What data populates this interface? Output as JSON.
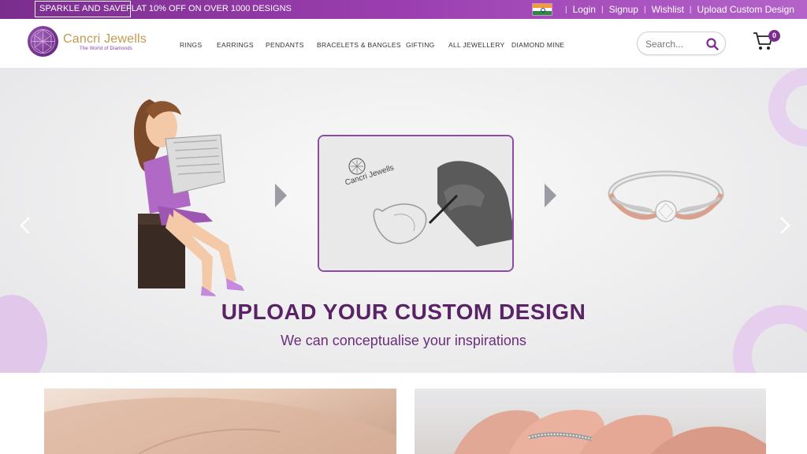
{
  "topbar": {
    "promo_badge": "SPARKLE AND SAVE",
    "promo_text": "FLAT 10% OFF ON OVER 1000 DESIGNS",
    "links": {
      "login": "Login",
      "signup": "Signup",
      "wishlist": "Wishlist",
      "upload": "Upload Custom Design"
    },
    "separator": "|"
  },
  "header": {
    "logo_name": "Cancri Jewells",
    "logo_tagline": "The World of Diamonds",
    "nav": [
      "RINGS",
      "EARRINGS",
      "PENDANTS",
      "BRACELETS & BANGLES",
      "GIFTING",
      "ALL JEWELLERY",
      "DIAMOND MINE"
    ],
    "search_placeholder": "Search...",
    "cart_count": "0"
  },
  "hero": {
    "title": "UPLOAD YOUR CUSTOM DESIGN",
    "subtitle": "We can conceptualise your inspirations",
    "sketch_brand": "Cancri Jewells"
  },
  "colors": {
    "brand_purple": "#7b2d8e",
    "logo_gold": "#c39a4d",
    "hero_title": "#5a2366",
    "deco_lilac": "#e6cfee"
  }
}
